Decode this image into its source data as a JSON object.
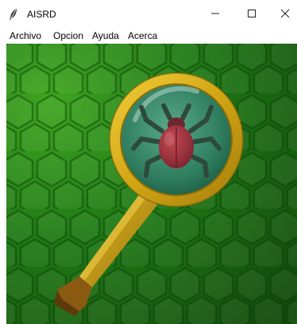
{
  "window": {
    "title": "AISRD",
    "app_icon": "feather-icon",
    "controls": {
      "minimize": "minimize-icon",
      "maximize": "maximize-icon",
      "close": "close-icon"
    }
  },
  "menubar": {
    "items": [
      {
        "label": "Archivo"
      },
      {
        "label": "Opcion"
      },
      {
        "label": "Ayuda"
      },
      {
        "label": "Acerca"
      }
    ]
  },
  "splash": {
    "image": "magnifying-glass-with-bug",
    "colors": {
      "background": "#1f6b12",
      "hexagon": "#3a9a22",
      "ring": "#d9b21a",
      "handle": "#c9a017",
      "lens": "#3f8f6f",
      "bug": "#a8343f"
    }
  }
}
